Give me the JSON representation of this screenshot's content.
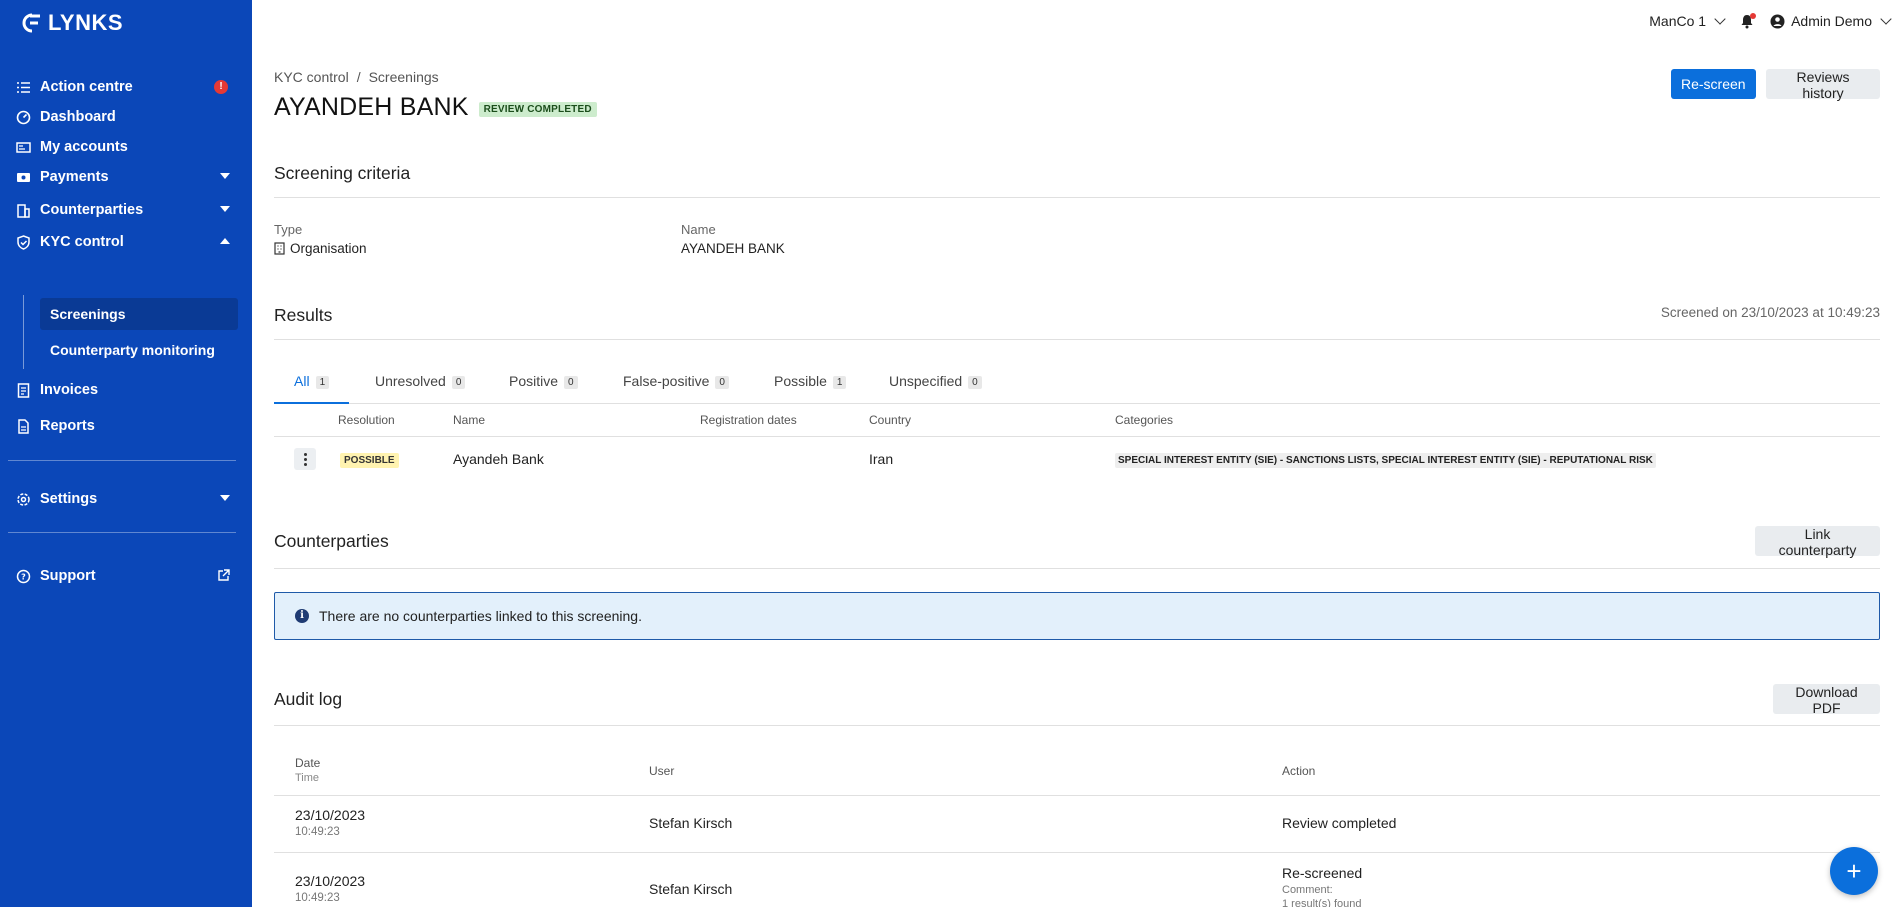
{
  "app": {
    "brand": "LYNKS"
  },
  "sidebar": {
    "items": [
      {
        "label": "Action centre",
        "alert": "!"
      },
      {
        "label": "Dashboard"
      },
      {
        "label": "My accounts"
      },
      {
        "label": "Payments"
      },
      {
        "label": "Counterparties"
      },
      {
        "label": "KYC control"
      },
      {
        "label": "Invoices"
      },
      {
        "label": "Reports"
      },
      {
        "label": "Settings"
      },
      {
        "label": "Support"
      }
    ],
    "kyc_sub": [
      {
        "label": "Screenings",
        "active": true
      },
      {
        "label": "Counterparty monitoring"
      }
    ]
  },
  "topbar": {
    "company": "ManCo 1",
    "user": "Admin Demo"
  },
  "breadcrumb": {
    "parent": "KYC control",
    "separator": "/",
    "current": "Screenings"
  },
  "page": {
    "title": "AYANDEH BANK",
    "status": "REVIEW COMPLETED"
  },
  "actions": {
    "rescreen": "Re-screen",
    "reviews_history": "Reviews history"
  },
  "criteria": {
    "section_title": "Screening criteria",
    "type_label": "Type",
    "type_value": "Organisation",
    "name_label": "Name",
    "name_value": "AYANDEH BANK"
  },
  "results": {
    "section_title": "Results",
    "screened_on": "Screened on 23/10/2023 at 10:49:23",
    "tabs": [
      {
        "label": "All",
        "count": "1",
        "active": true
      },
      {
        "label": "Unresolved",
        "count": "0"
      },
      {
        "label": "Positive",
        "count": "0"
      },
      {
        "label": "False-positive",
        "count": "0"
      },
      {
        "label": "Possible",
        "count": "1"
      },
      {
        "label": "Unspecified",
        "count": "0"
      }
    ],
    "columns": [
      "Resolution",
      "Name",
      "Registration dates",
      "Country",
      "Categories"
    ],
    "rows": [
      {
        "resolution": "POSSIBLE",
        "name": "Ayandeh Bank",
        "registration_dates": "",
        "country": "Iran",
        "categories": "SPECIAL INTEREST ENTITY (SIE) - SANCTIONS LISTS, SPECIAL INTEREST ENTITY (SIE) - REPUTATIONAL RISK"
      }
    ]
  },
  "counterparties": {
    "section_title": "Counterparties",
    "link_button": "Link counterparty",
    "empty_message": "There are no counterparties linked to this screening."
  },
  "audit": {
    "section_title": "Audit log",
    "download_button": "Download PDF",
    "columns": {
      "date": "Date",
      "time": "Time",
      "user": "User",
      "action": "Action"
    },
    "rows": [
      {
        "date": "23/10/2023",
        "time": "10:49:23",
        "user": "Stefan Kirsch",
        "action": "Review completed"
      },
      {
        "date": "23/10/2023",
        "time": "10:49:23",
        "user": "Stefan Kirsch",
        "action": "Re-screened",
        "comment_label": "Comment:",
        "comment": "1 result(s) found"
      }
    ]
  },
  "fab": {
    "label": "+"
  },
  "colors": {
    "sidebar": "#0b47b8",
    "primary": "#0b6fdc",
    "alert": "#e53935"
  }
}
